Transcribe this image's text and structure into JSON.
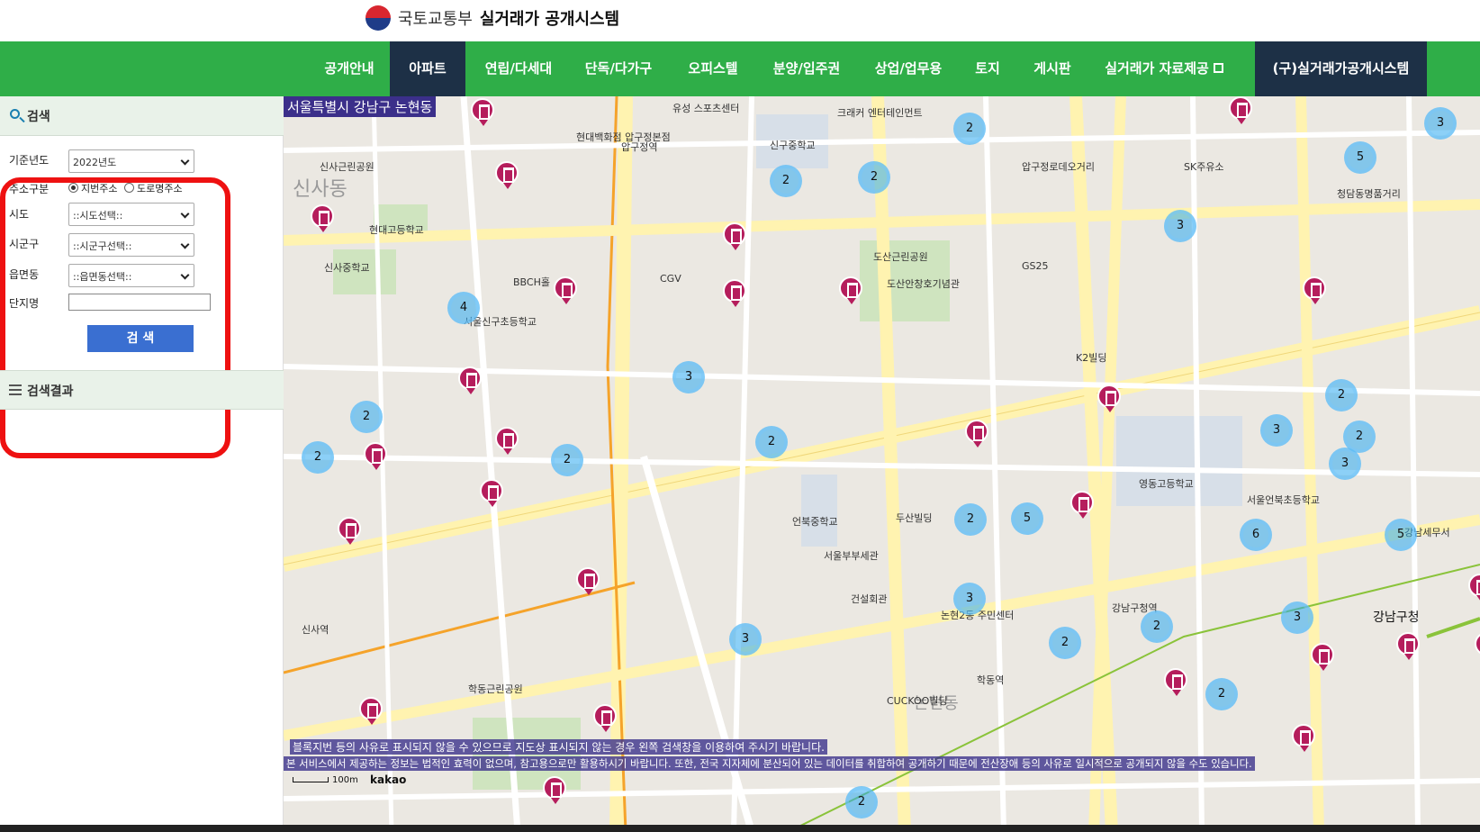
{
  "header": {
    "ministry": "국토교통부",
    "system_name": "실거래가 공개시스템",
    "brand_colors": {
      "red": "#d8262f",
      "blue": "#1f3c88"
    }
  },
  "nav": {
    "color": "#2fae48",
    "active_color": "#1d3046",
    "items": [
      {
        "label": "공개안내"
      },
      {
        "label": "아파트",
        "active": true
      },
      {
        "label": "연립/다세대"
      },
      {
        "label": "단독/다가구"
      },
      {
        "label": "오피스텔"
      },
      {
        "label": "분양/입주권"
      },
      {
        "label": "상업/업무용"
      },
      {
        "label": "토지"
      },
      {
        "label": "게시판"
      },
      {
        "label": "실거래가 자료제공",
        "icon": "external-link-icon"
      },
      {
        "label": "(구)실거래가공개시스템",
        "active": true
      }
    ]
  },
  "sidebar": {
    "search_title": "검색",
    "fields": {
      "year_label": "기준년도",
      "year_value": "2022년도",
      "address_type_label": "주소구분",
      "address_options": [
        "지번주소",
        "도로명주소"
      ],
      "address_selected": "지번주소",
      "sido_label": "시도",
      "sido_value": "::시도선택::",
      "sigungu_label": "시군구",
      "sigungu_value": "::시군구선택::",
      "dong_label": "읍면동",
      "dong_value": "::읍면동선택::",
      "complex_label": "단지명",
      "complex_value": ""
    },
    "search_button": "검 색",
    "results_title": "검색결과"
  },
  "map": {
    "region": "서울특별시 강남구 논현동",
    "clusters": [
      "2",
      "2",
      "4",
      "2",
      "2",
      "3",
      "2",
      "3",
      "2",
      "2",
      "5",
      "3",
      "2",
      "2",
      "6",
      "5",
      "3",
      "3",
      "3",
      "2",
      "2",
      "3",
      "2",
      "5",
      "2",
      "2",
      "3"
    ],
    "pin_count": 27,
    "place_labels": [
      "현대백화점 압구정본점",
      "유성 스포츠센터",
      "크래커 엔터테인먼트",
      "신사근린공원",
      "현대고등학교",
      "신구중학교",
      "신사중학교",
      "서울신구초등학교",
      "압구정로데오거리",
      "도산근린공원",
      "도산안창호기념관",
      "논현동",
      "신사동",
      "학동근린공원",
      "강남구청",
      "영동고등학교",
      "서울언북초등학교",
      "청담동명품거리",
      "K2빌딩",
      "SK주유소",
      "강남세무서",
      "CGV",
      "GS25",
      "BBCH홀",
      "CUCKOO빌딩",
      "논현2동 주민센터",
      "언북중학교",
      "신사역",
      "압구정역",
      "서울부부세관",
      "건설회관",
      "두산빌딩",
      "학동역",
      "강남구청역"
    ],
    "notices": [
      "블록지번 등의 사유로 표시되지 않을 수 있으므로 지도상 표시되지 않는 경우 왼쪽 검색창을 이용하여 주시기 바랍니다.",
      "본 서비스에서 제공하는 정보는 법적인 효력이 없으며, 참고용으로만 활용하시기 바랍니다. 또한, 전국 지자체에 분산되어 있는 데이터를 취합하여 공개하기 때문에 전산장애 등의 사유로 일시적으로 공개되지 않을 수도 있습니다."
    ],
    "scale": "100m",
    "provider": "kakao"
  }
}
